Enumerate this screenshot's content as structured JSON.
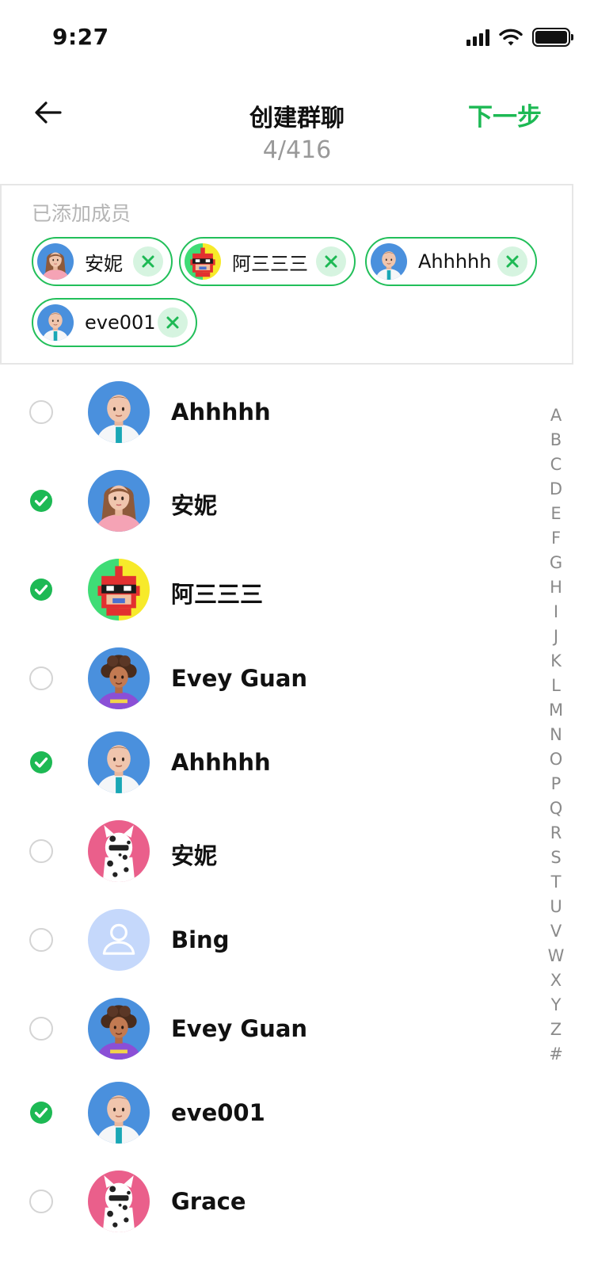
{
  "status_bar": {
    "time": "9:27",
    "icons": [
      "cellular-signal-icon",
      "wifi-icon",
      "battery-icon"
    ]
  },
  "nav": {
    "back_icon": "arrow-left-icon",
    "title": "创建群聊",
    "subtitle": "4/416",
    "next_label": "下一步"
  },
  "added": {
    "title": "已添加成员",
    "members": [
      {
        "name": "安妮",
        "avatar": "avatar-woman-3d"
      },
      {
        "name": "阿三三三",
        "avatar": "avatar-pixel-hero"
      },
      {
        "name": "Ahhhhh",
        "avatar": "avatar-man-3d"
      },
      {
        "name": "eve001",
        "avatar": "avatar-man-3d"
      }
    ],
    "remove_icon": "close-icon"
  },
  "contacts": [
    {
      "name": "Ahhhhh",
      "selected": false,
      "avatar": "avatar-man-3d"
    },
    {
      "name": "安妮",
      "selected": true,
      "avatar": "avatar-woman-3d"
    },
    {
      "name": "阿三三三",
      "selected": true,
      "avatar": "avatar-pixel-hero"
    },
    {
      "name": "Evey Guan",
      "selected": false,
      "avatar": "avatar-curly-3d"
    },
    {
      "name": "Ahhhhh",
      "selected": true,
      "avatar": "avatar-man-3d"
    },
    {
      "name": "安妮",
      "selected": false,
      "avatar": "avatar-cat-pink"
    },
    {
      "name": "Bing",
      "selected": false,
      "avatar": "avatar-placeholder"
    },
    {
      "name": "Evey Guan",
      "selected": false,
      "avatar": "avatar-curly-3d"
    },
    {
      "name": "eve001",
      "selected": true,
      "avatar": "avatar-man-3d"
    },
    {
      "name": "Grace",
      "selected": false,
      "avatar": "avatar-cat-pink"
    }
  ],
  "alphabet": [
    "A",
    "B",
    "C",
    "D",
    "E",
    "F",
    "G",
    "H",
    "I",
    "J",
    "K",
    "L",
    "M",
    "N",
    "O",
    "P",
    "Q",
    "R",
    "S",
    "T",
    "U",
    "V",
    "W",
    "X",
    "Y",
    "Z",
    "#"
  ],
  "colors": {
    "accent": "#1db954",
    "chip_border": "#22bf5a",
    "muted": "#999999",
    "divider": "#e6e6e6"
  }
}
